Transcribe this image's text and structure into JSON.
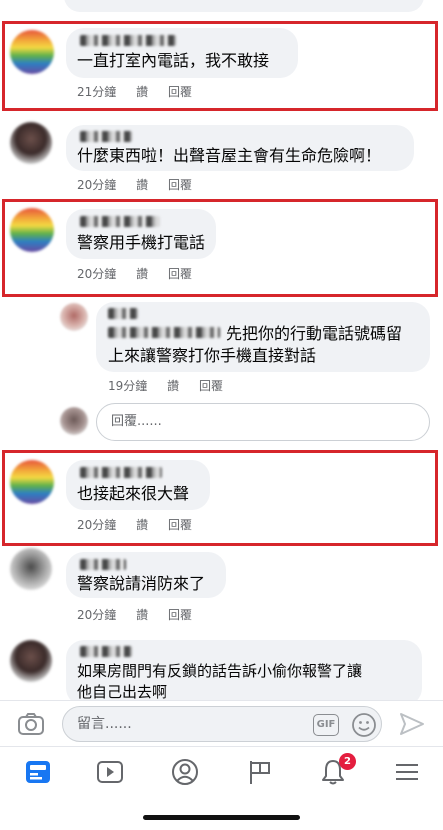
{
  "comments": [
    {
      "text": "一直打室內電話，我不敢接",
      "time": "21分鐘",
      "like": "讚",
      "reply": "回覆"
    },
    {
      "text": "什麼東西啦！出聲音屋主會有生命危險啊！",
      "time": "20分鐘",
      "like": "讚",
      "reply": "回覆"
    },
    {
      "text": "警察用手機打電話",
      "time": "20分鐘",
      "like": "讚",
      "reply": "回覆"
    },
    {
      "text": "先把你的行動電話號碼留上來讓警察打你手機直接對話",
      "line1": "先把你的行動電話號碼留",
      "line2": "上來讓警察打你手機直接對話",
      "time": "19分鐘",
      "like": "讚",
      "reply": "回覆"
    },
    {
      "text": "也接起來很大聲",
      "time": "20分鐘",
      "like": "讚",
      "reply": "回覆"
    },
    {
      "text": "警察說請消防來了",
      "time": "20分鐘",
      "like": "讚",
      "reply": "回覆"
    },
    {
      "line1": "如果房間門有反鎖的話告訴小偷你報警了讓",
      "line2": "他自己出去啊"
    }
  ],
  "reply_box": {
    "placeholder": "回覆......"
  },
  "composer": {
    "placeholder": "留言......",
    "gif_label": "GIF"
  },
  "tabbar": {
    "notification_badge": "2"
  },
  "colors": {
    "highlight": "#d6262b",
    "bubble": "#f0f2f5",
    "meta": "#65676b",
    "badge": "#e41e3f",
    "active_tab": "#1877f2"
  },
  "icons": [
    "camera-icon",
    "gif-icon",
    "emoji-icon",
    "send-icon",
    "feed-icon",
    "watch-icon",
    "profile-icon",
    "flag-icon",
    "bell-icon",
    "menu-icon"
  ]
}
